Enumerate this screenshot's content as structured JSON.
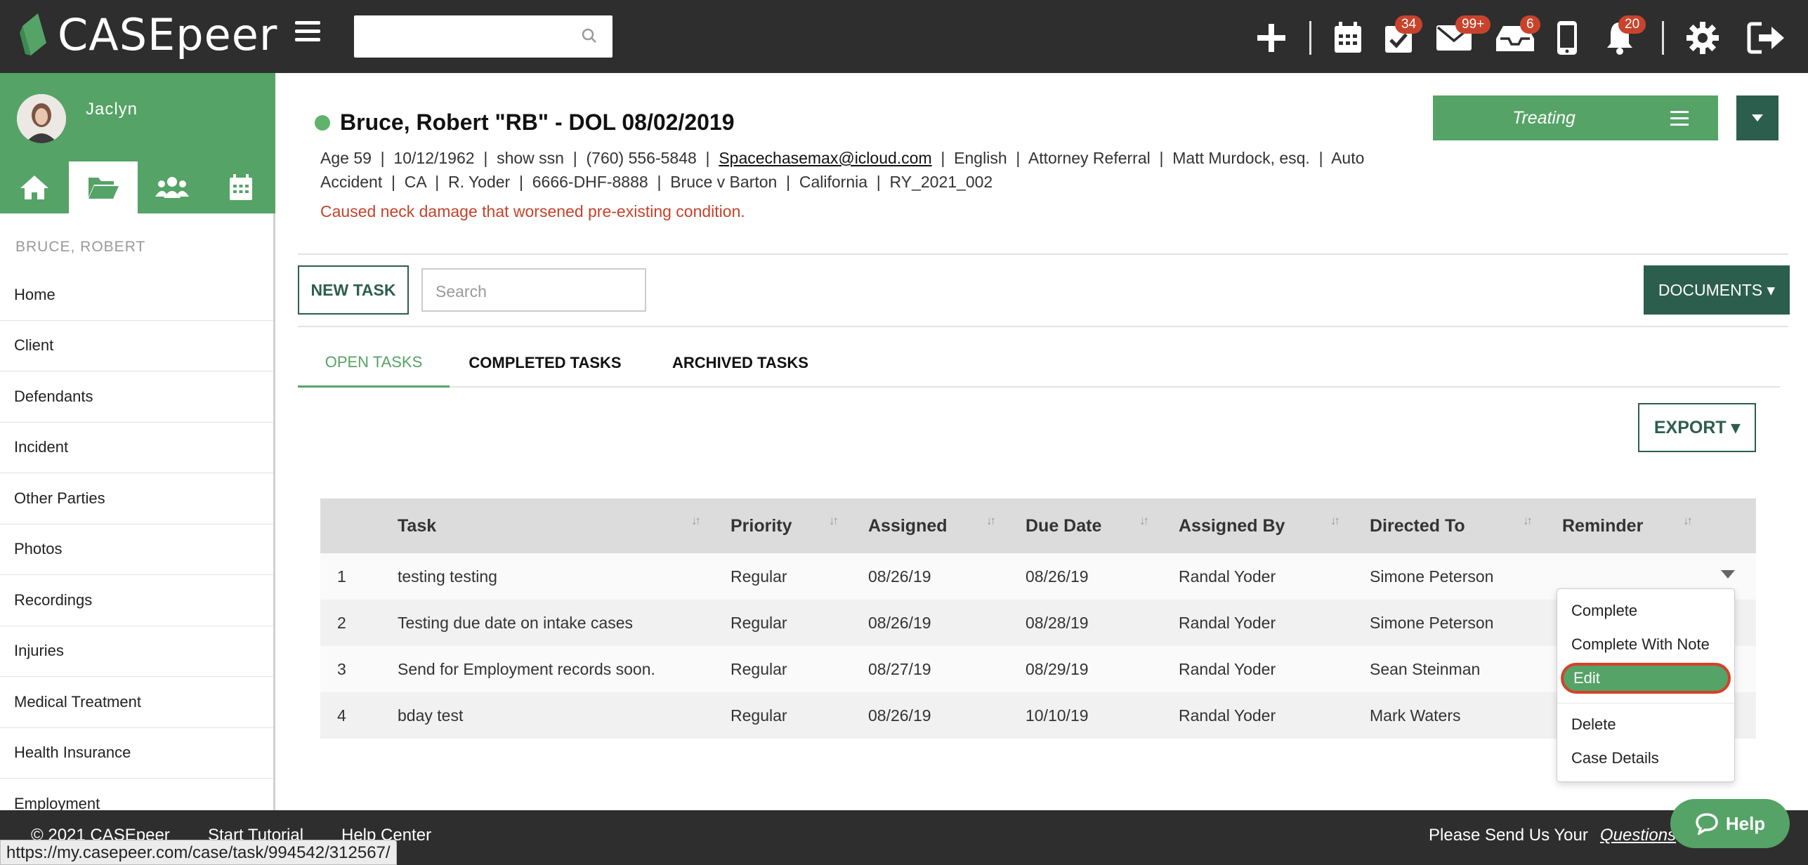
{
  "app": {
    "logo_text": "CASEpeer"
  },
  "topbar": {
    "search_placeholder": "",
    "badges": {
      "tasks": "34",
      "mail": "99+",
      "inbox": "6",
      "notifications": "20"
    }
  },
  "sidebar": {
    "user_name": "Jaclyn",
    "case_name": "BRUCE, ROBERT",
    "items": [
      "Home",
      "Client",
      "Defendants",
      "Incident",
      "Other Parties",
      "Photos",
      "Recordings",
      "Injuries",
      "Medical Treatment",
      "Health Insurance",
      "Employment"
    ]
  },
  "case": {
    "title": "Bruce, Robert \"RB\" - DOL 08/02/2019",
    "info_line1_a": "Age 59  |  10/12/1962  |  show ssn  |  (760) 556-5848  |  ",
    "email": "Spacechasemax@icloud.com",
    "info_line1_b": "  |  English  |  Attorney Referral  |  Matt Murdock, esq.  |  Auto",
    "info_line2": "Accident  |  CA  |  R. Yoder  |  6666-DHF-8888  |  Bruce v Barton  |  California  |  RY_2021_002",
    "note": "Caused neck damage that worsened pre-existing condition.",
    "status": "Treating"
  },
  "toolbar": {
    "new_task": "NEW TASK",
    "search_placeholder": "Search",
    "documents": "DOCUMENTS ▾",
    "export": "EXPORT ▾"
  },
  "tabs": {
    "open": "OPEN TASKS",
    "completed": "COMPLETED TASKS",
    "archived": "ARCHIVED TASKS"
  },
  "table": {
    "headers": {
      "task": "Task",
      "priority": "Priority",
      "assigned": "Assigned",
      "due": "Due Date",
      "assigned_by": "Assigned By",
      "directed_to": "Directed To",
      "reminder": "Reminder"
    },
    "rows": [
      {
        "num": "1",
        "task": "testing testing",
        "priority": "Regular",
        "assigned": "08/26/19",
        "due": "08/26/19",
        "assigned_by": "Randal Yoder",
        "directed_to": "Simone Peterson"
      },
      {
        "num": "2",
        "task": "Testing due date on intake cases",
        "priority": "Regular",
        "assigned": "08/26/19",
        "due": "08/28/19",
        "assigned_by": "Randal Yoder",
        "directed_to": "Simone Peterson"
      },
      {
        "num": "3",
        "task": "Send for Employment records soon.",
        "priority": "Regular",
        "assigned": "08/27/19",
        "due": "08/29/19",
        "assigned_by": "Randal Yoder",
        "directed_to": "Sean Steinman"
      },
      {
        "num": "4",
        "task": "bday test",
        "priority": "Regular",
        "assigned": "08/26/19",
        "due": "10/10/19",
        "assigned_by": "Randal Yoder",
        "directed_to": "Mark Waters"
      }
    ]
  },
  "row_menu": {
    "complete": "Complete",
    "complete_note": "Complete With Note",
    "edit": "Edit",
    "delete": "Delete",
    "case_details": "Case Details"
  },
  "footer": {
    "copyright": "© 2021 CASEpeer",
    "tutorial": "Start Tutorial",
    "help_center": "Help Center",
    "send_us": "Please Send Us Your",
    "questions": "Questions",
    "help_button": "Help"
  },
  "status_url": "https://my.casepeer.com/case/task/994542/312567/",
  "colors": {
    "brand_green": "#55a366",
    "dark_green": "#2c5e4e",
    "topbar": "#2e2e2e",
    "badge_red": "#c9432c",
    "highlight_red": "#d6402b"
  }
}
